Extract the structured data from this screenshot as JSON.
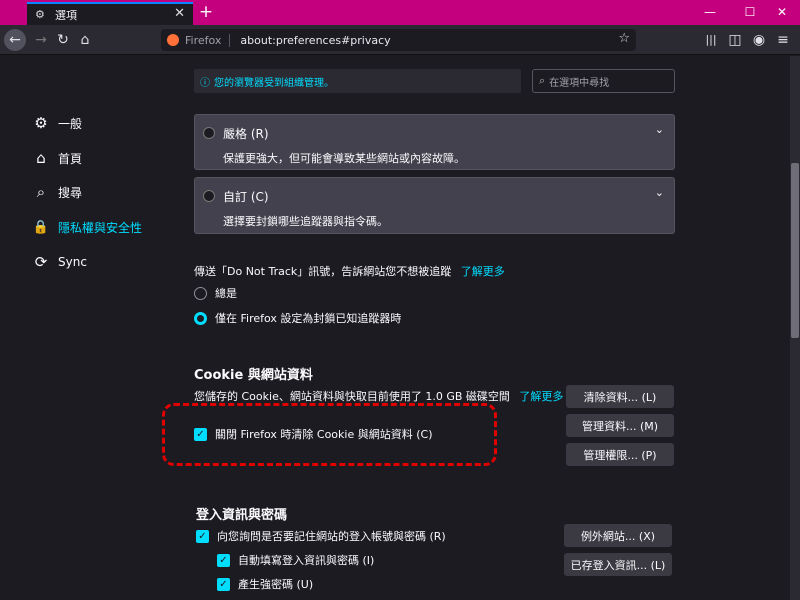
{
  "window": {
    "tab_title": "選項",
    "new_tab_glyph": "+",
    "close_tab_glyph": "✕",
    "min_glyph": "—",
    "max_glyph": "☐",
    "close_glyph": "✕"
  },
  "nav": {
    "back_glyph": "←",
    "forward_glyph": "→",
    "reload_glyph": "↻",
    "home_glyph": "⌂",
    "identity_label": "Firefox",
    "url": "about:preferences#privacy",
    "star_glyph": "☆",
    "library_glyph": "|||",
    "sidebar_glyph": "◫",
    "account_glyph": "◉",
    "menu_glyph": "≡"
  },
  "sidebar": {
    "items": [
      {
        "label": "一般",
        "icon": "gear-icon",
        "glyph": "⚙"
      },
      {
        "label": "首頁",
        "icon": "home-icon",
        "glyph": "⌂"
      },
      {
        "label": "搜尋",
        "icon": "search-icon",
        "glyph": "⌕"
      },
      {
        "label": "隱私權與安全性",
        "icon": "lock-icon",
        "glyph": "🔒"
      },
      {
        "label": "Sync",
        "icon": "sync-icon",
        "glyph": "⟳"
      }
    ]
  },
  "notice": {
    "icon_glyph": "ⓘ",
    "text": "您的瀏覽器受到組織管理。"
  },
  "search": {
    "icon_glyph": "⌕",
    "placeholder": "在選項中尋找"
  },
  "tracking": {
    "strict_title": "嚴格 (R)",
    "strict_desc": "保護更強大，但可能會導致某些網站或內容故障。",
    "custom_title": "自訂 (C)",
    "custom_desc": "選擇要封鎖哪些追蹤器與指令碼。",
    "chevron_glyph": "⌄"
  },
  "dnt": {
    "label": "傳送「Do Not Track」訊號，告訴網站您不想被追蹤",
    "learn_more": "了解更多",
    "option_always": "總是",
    "option_blocking": "僅在 Firefox 設定為封鎖已知追蹤器時"
  },
  "cookies": {
    "heading": "Cookie 與網站資料",
    "usage": "您儲存的 Cookie、網站資料與快取目前使用了 1.0 GB 磁碟空間",
    "learn_more": "了解更多",
    "clear_button": "清除資料... (L)",
    "manage_button": "管理資料... (M)",
    "permissions_button": "管理權限... (P)",
    "delete_on_close": "關閉 Firefox 時清除 Cookie 與網站資料 (C)"
  },
  "logins": {
    "heading": "登入資訊與密碼",
    "ask_save": "向您詢問是否要記住網站的登入帳號與密碼 (R)",
    "autofill": "自動填寫登入資訊與密碼 (I)",
    "generate": "產生強密碼 (U)",
    "exceptions_button": "例外網站... (X)",
    "saved_button": "已存登入資訊... (L)",
    "check_glyph": "✓"
  }
}
